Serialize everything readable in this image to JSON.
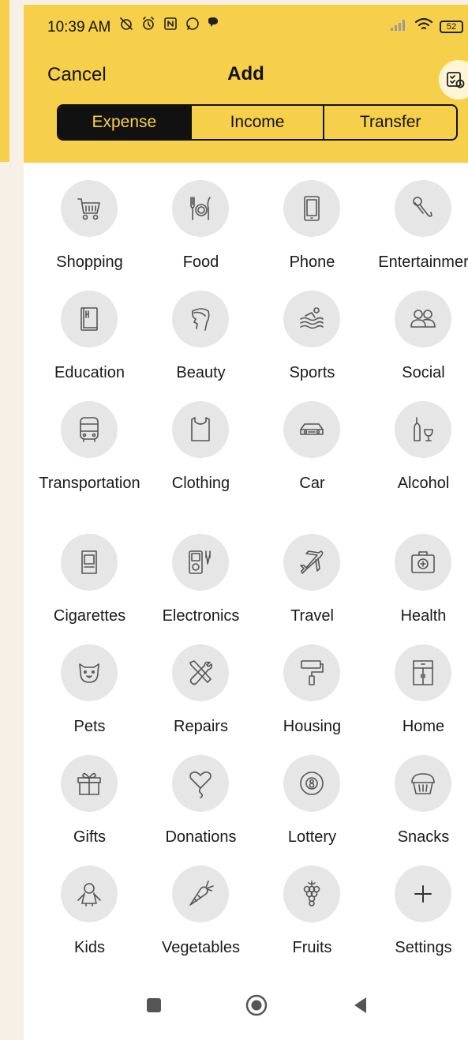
{
  "status_bar": {
    "time": "10:39 AM",
    "battery": "52"
  },
  "header": {
    "cancel_label": "Cancel",
    "title": "Add",
    "tabs": [
      {
        "label": "Expense",
        "active": true
      },
      {
        "label": "Income",
        "active": false
      },
      {
        "label": "Transfer",
        "active": false
      }
    ]
  },
  "categories": [
    {
      "label": "Shopping",
      "icon": "shopping-cart-icon"
    },
    {
      "label": "Food",
      "icon": "cutlery-icon"
    },
    {
      "label": "Phone",
      "icon": "phone-icon"
    },
    {
      "label": "Entertainmer",
      "icon": "microphone-icon"
    },
    {
      "label": "Education",
      "icon": "book-icon"
    },
    {
      "label": "Beauty",
      "icon": "face-profile-icon"
    },
    {
      "label": "Sports",
      "icon": "swimmer-icon"
    },
    {
      "label": "Social",
      "icon": "people-icon"
    },
    {
      "label": "Transportation",
      "icon": "bus-icon"
    },
    {
      "label": "Clothing",
      "icon": "tank-top-icon"
    },
    {
      "label": "Car",
      "icon": "car-icon"
    },
    {
      "label": "Alcohol",
      "icon": "bottle-glass-icon"
    },
    {
      "label": "Cigarettes",
      "icon": "cigarette-pack-icon"
    },
    {
      "label": "Electronics",
      "icon": "media-player-icon"
    },
    {
      "label": "Travel",
      "icon": "airplane-icon"
    },
    {
      "label": "Health",
      "icon": "first-aid-icon"
    },
    {
      "label": "Pets",
      "icon": "pet-face-icon"
    },
    {
      "label": "Repairs",
      "icon": "wrench-screwdriver-icon"
    },
    {
      "label": "Housing",
      "icon": "paint-roller-icon"
    },
    {
      "label": "Home",
      "icon": "cabinet-icon"
    },
    {
      "label": "Gifts",
      "icon": "gift-icon"
    },
    {
      "label": "Donations",
      "icon": "heart-balloon-icon"
    },
    {
      "label": "Lottery",
      "icon": "eight-ball-icon"
    },
    {
      "label": "Snacks",
      "icon": "cupcake-icon"
    },
    {
      "label": "Kids",
      "icon": "child-icon"
    },
    {
      "label": "Vegetables",
      "icon": "carrot-icon"
    },
    {
      "label": "Fruits",
      "icon": "grapes-icon"
    },
    {
      "label": "Settings",
      "icon": "plus-icon"
    }
  ],
  "colors": {
    "accent": "#f7d04b",
    "tab_active_bg": "#111111",
    "icon_circle": "#e6e6e6"
  }
}
